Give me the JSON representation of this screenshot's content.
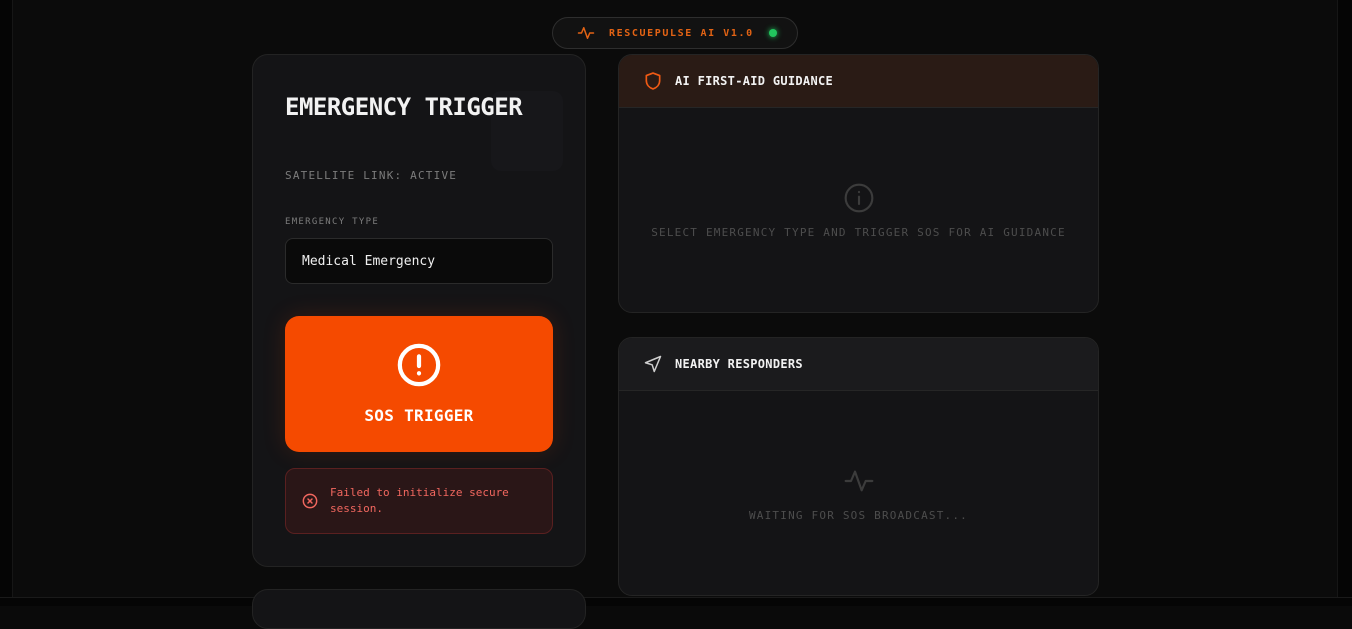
{
  "header": {
    "app_title": "RESCUEPULSE AI V1.0",
    "status_color": "#22c55e"
  },
  "trigger_card": {
    "title": "EMERGENCY TRIGGER",
    "subtitle": "SATELLITE LINK: ACTIVE",
    "type_label": "EMERGENCY TYPE",
    "selected_type": "Medical Emergency",
    "sos_label": "SOS TRIGGER",
    "error_message": "Failed to initialize secure session."
  },
  "guidance_panel": {
    "title": "AI FIRST-AID GUIDANCE",
    "placeholder": "SELECT EMERGENCY TYPE AND TRIGGER SOS FOR AI GUIDANCE"
  },
  "responders_panel": {
    "title": "NEARBY RESPONDERS",
    "placeholder": "WAITING FOR SOS BROADCAST..."
  },
  "colors": {
    "accent": "#f54a00",
    "error": "#f2675f",
    "background": "#0b0b0b",
    "card": "#141416"
  }
}
